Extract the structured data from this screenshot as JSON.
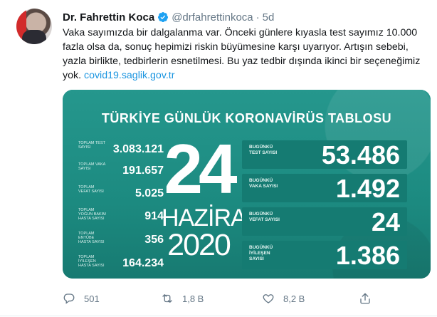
{
  "tweet": {
    "author_name": "Dr. Fahrettin Koca",
    "handle": "@drfahrettinkoca",
    "separator": "·",
    "time": "5d",
    "text": "Vaka sayımızda bir dalgalanma var. Önceki günlere kıyasla test sayımız 10.000 fazla olsa da, sonuç hepimizi riskin büyümesine karşı uyarıyor. Artışın sebebi, yazla birlikte, tedbirlerin esnetilmesi. Bu yaz tedbir dışında ikinci bir seçeneğimiz yok.",
    "link": "covid19.saglik.gov.tr"
  },
  "card": {
    "title": "TÜRKİYE GÜNLÜK KORONAVİRÜS TABLOSU",
    "totals": [
      {
        "label": "TOPLAM TEST SAYISI",
        "value": "3.083.121"
      },
      {
        "label": "TOPLAM VAKA SAYISI",
        "value": "191.657"
      },
      {
        "label": "TOPLAM VEFAT SAYISI",
        "value": "5.025"
      },
      {
        "label": "TOPLAM YOĞUN BAKIM HASTA SAYISI",
        "value": "914"
      },
      {
        "label": "TOPLAM ENTÜBE HASTA SAYISI",
        "value": "356"
      },
      {
        "label": "TOPLAM İYİLEŞEN HASTA SAYISI",
        "value": "164.234"
      }
    ],
    "date_day": "24",
    "date_month": "HAZİRAN",
    "date_year": "2020",
    "today": [
      {
        "label": "BUGÜNKÜ TEST SAYISI",
        "value": "53.486"
      },
      {
        "label": "BUGÜNKÜ VAKA SAYISI",
        "value": "1.492"
      },
      {
        "label": "BUGÜNKÜ VEFAT SAYISI",
        "value": "24"
      },
      {
        "label": "BUGÜNKÜ İYİLEŞEN SAYISI",
        "value": "1.386"
      }
    ]
  },
  "actions": {
    "reply_count": "501",
    "retweet_count": "1,8 B",
    "like_count": "8,2 B"
  },
  "colors": {
    "card_teal": "#1f8f86",
    "link_blue": "#1b95e0",
    "verified_blue": "#1da1f2"
  }
}
